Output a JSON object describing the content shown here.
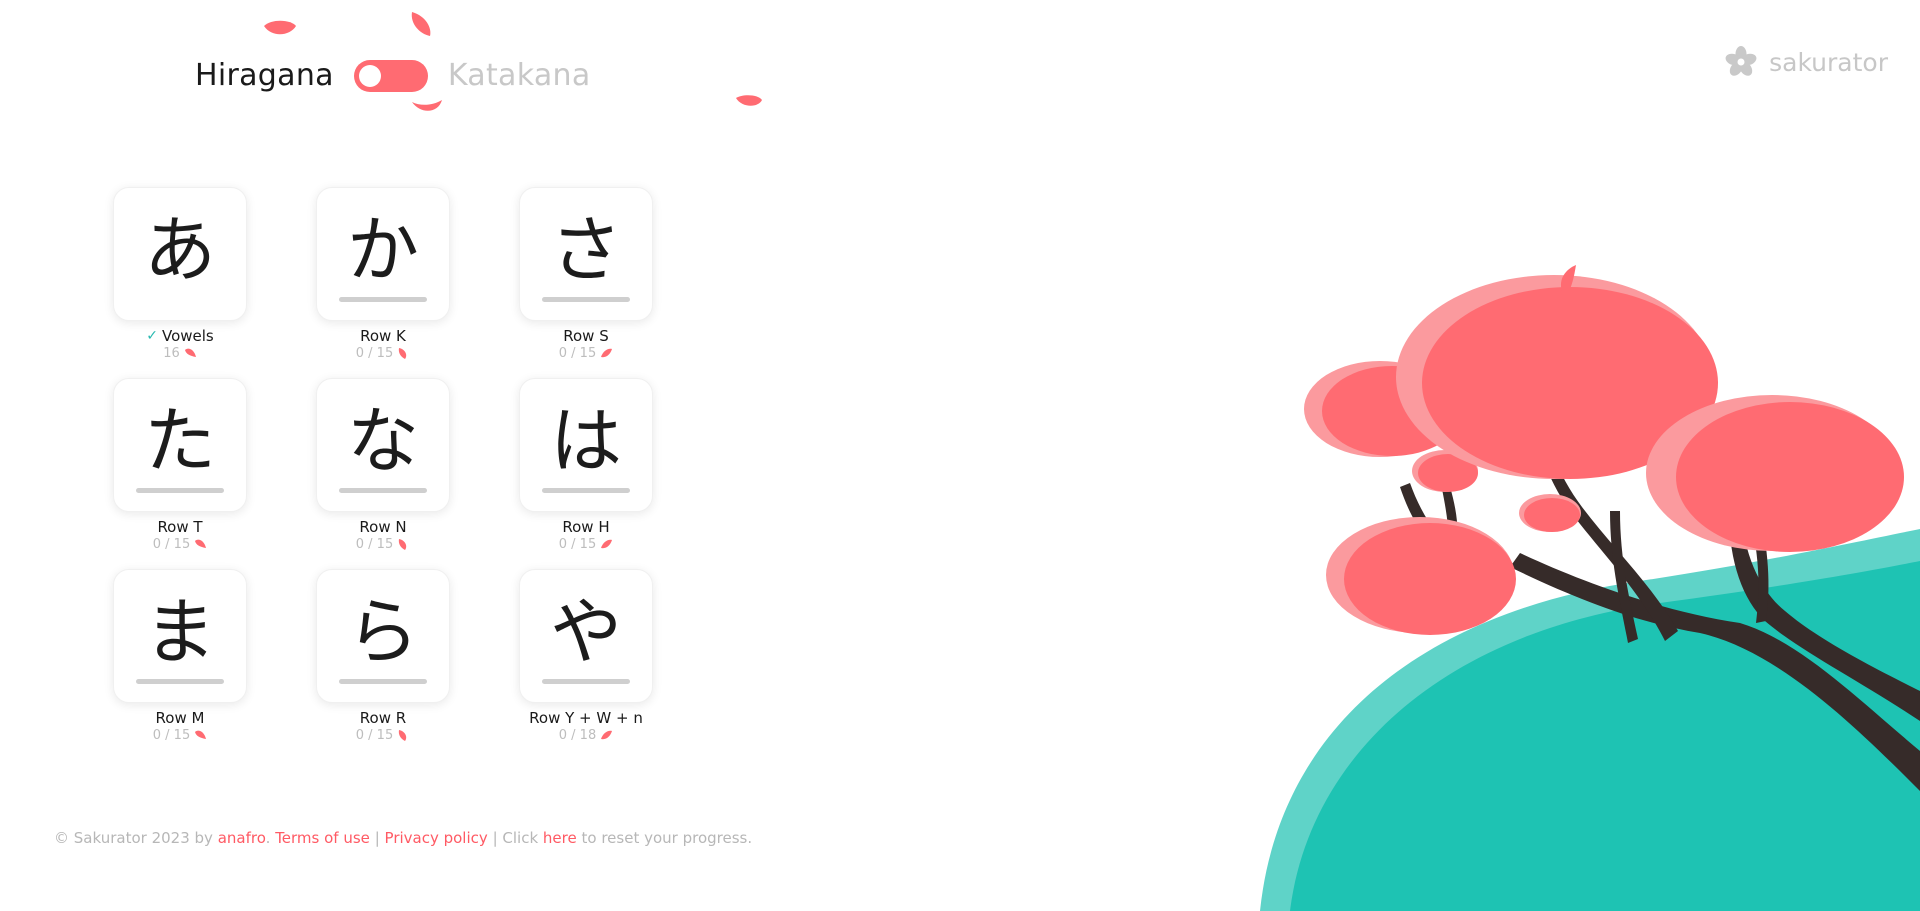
{
  "header": {
    "hiragana_label": "Hiragana",
    "katakana_label": "Katakana",
    "mode_toggle_state": "hiragana"
  },
  "brand": {
    "name": "sakurator",
    "icon": "flower-icon"
  },
  "lessons": [
    {
      "glyph": "あ",
      "title": "Vowels",
      "progress": "16",
      "completed": true
    },
    {
      "glyph": "か",
      "title": "Row K",
      "progress": "0 / 15",
      "completed": false
    },
    {
      "glyph": "さ",
      "title": "Row S",
      "progress": "0 / 15",
      "completed": false
    },
    {
      "glyph": "た",
      "title": "Row T",
      "progress": "0 / 15",
      "completed": false
    },
    {
      "glyph": "な",
      "title": "Row N",
      "progress": "0 / 15",
      "completed": false
    },
    {
      "glyph": "は",
      "title": "Row H",
      "progress": "0 / 15",
      "completed": false
    },
    {
      "glyph": "ま",
      "title": "Row M",
      "progress": "0 / 15",
      "completed": false
    },
    {
      "glyph": "ら",
      "title": "Row R",
      "progress": "0 / 15",
      "completed": false
    },
    {
      "glyph": "や",
      "title": "Row Y + W + n",
      "progress": "0 / 18",
      "completed": false
    }
  ],
  "completed_mark": "✓",
  "footer": {
    "copyright": "© Sakurator 2023 by",
    "author_link": "anafro",
    "dot": ".",
    "terms_link": "Terms of use",
    "sep1": "|",
    "privacy_link": "Privacy policy",
    "sep2": "| Click",
    "reset_link": "here",
    "tail": "to reset your progress."
  },
  "colors": {
    "accent": "#ff6b72",
    "petal": "#ff6b72",
    "petal_light": "#fb9a9e",
    "hill": "#1ec3b3",
    "hill_light": "#5fd3c8",
    "trunk": "#362b29",
    "check": "#28b9b0",
    "muted": "#c8c8c8"
  }
}
